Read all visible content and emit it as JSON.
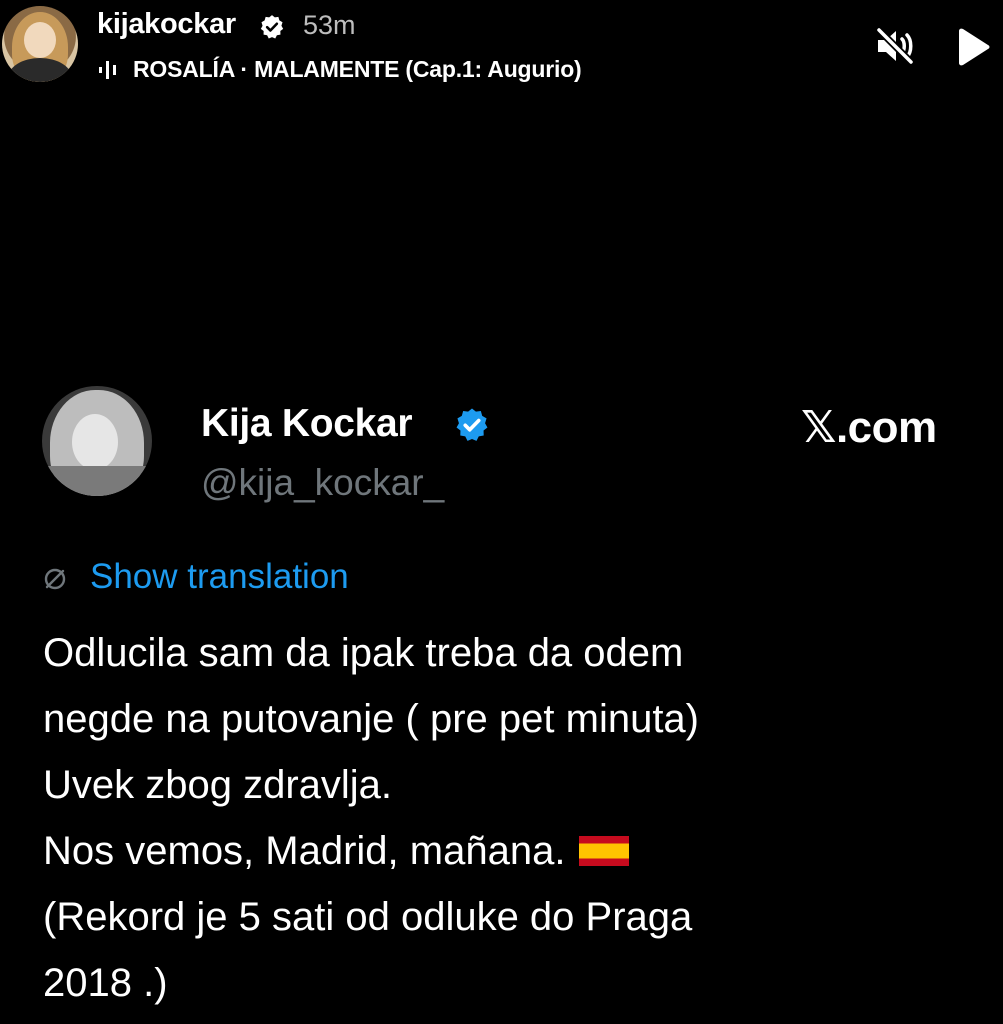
{
  "story": {
    "username": "kijakockar",
    "time_ago": "53m",
    "music": "ROSALÍA · MALAMENTE (Cap.1: Augurio)",
    "icons": [
      "avatar",
      "verified-icon",
      "music-bars-icon",
      "mute-icon",
      "play-icon"
    ]
  },
  "tweet": {
    "display_name": "Kija Kockar",
    "handle": "@kija_kockar_",
    "source": "𝕏.com",
    "show_translation": "Show translation",
    "lines": [
      "Odlucila sam da ipak treba da odem",
      "negde na putovanje ( pre pet minuta)",
      "Uvek zbog zdravlja.",
      "Nos vemos, Madrid, mañana.",
      "(Rekord je 5 sati od odluke do Praga",
      "2018 .)"
    ],
    "flag": "spain-flag-emoji",
    "accent_color": "#1d9bf0"
  }
}
